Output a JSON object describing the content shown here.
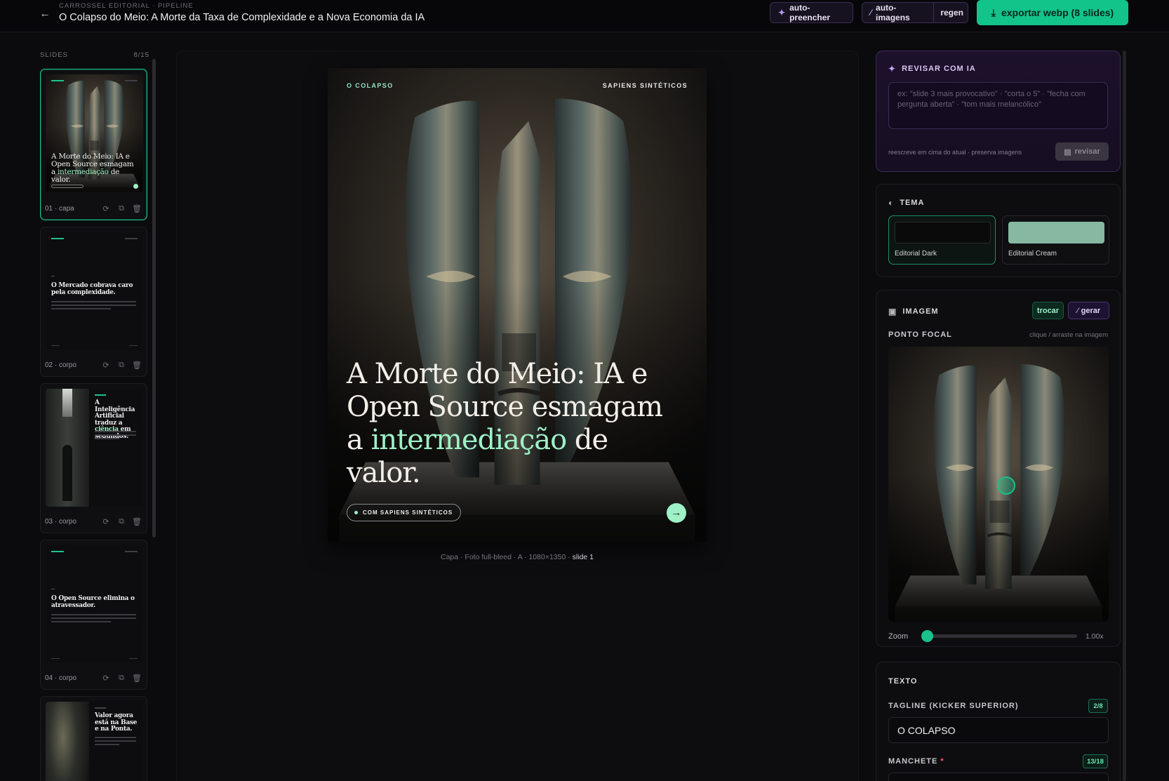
{
  "header": {
    "crumb": "CARROSSEL EDITORIAL · PIPELINE",
    "title": "O Colapso do Meio: A Morte da Taxa de Complexidade e a Nova Economia da IA",
    "auto_fill": "auto-preencher",
    "auto_images": "auto-imagens",
    "regen": "regen",
    "export": "exportar webp (8 slides)"
  },
  "sidebar": {
    "label": "SLIDES",
    "count": "8/15",
    "slides": [
      {
        "label": "01 · capa",
        "title": "A Morte do Meio: IA e Open Source esmagam a intermediação de valor."
      },
      {
        "label": "02 · corpo",
        "title": "O Mercado cobrava caro pela complexidade."
      },
      {
        "label": "03 · corpo",
        "title": "A Inteligência Artificial traduz a ciência em segundos."
      },
      {
        "label": "04 · corpo",
        "title": "O Open Source elimina o atravessador."
      },
      {
        "label": "05 · corpo",
        "title": "Valor agora está na Base e na Ponta."
      }
    ]
  },
  "card": {
    "tagline": "O COLAPSO",
    "brand": "SAPIENS SINTÉTICOS",
    "headline_pre": "A Morte do Meio: IA e Open Source esmagam a ",
    "headline_hl": "intermediação",
    "headline_post": " de valor.",
    "pill": "COM SAPIENS SINTÉTICOS",
    "next": "→"
  },
  "caption": {
    "meta": "Capa · Foto full-bleed · A · 1080×1350 ·",
    "slide": "slide 1"
  },
  "ai_panel": {
    "title": "REVISAR COM IA",
    "placeholder": "ex: \"slide 3 mais provocativo\" · \"corta o 5\" · \"fecha com pergunta aberta\" · \"tom mais melancólico\"",
    "hint": "reescreve em cima do atual · preserva imagens",
    "button": "revisar"
  },
  "theme_panel": {
    "title": "TEMA",
    "options": [
      {
        "name": "Editorial Dark",
        "color": "#0a0a0a"
      },
      {
        "name": "Editorial Cream",
        "color": "#86b8a2"
      }
    ]
  },
  "image_panel": {
    "title": "IMAGEM",
    "swap": "trocar",
    "generate": "gerar",
    "focal_label": "PONTO FOCAL",
    "focal_hint": "clique / arraste na imagem",
    "zoom_label": "Zoom",
    "zoom_value": "1.00x"
  },
  "text_panel": {
    "title": "TEXTO",
    "tagline_label": "TAGLINE (KICKER SUPERIOR)",
    "tagline_count": "2/8",
    "tagline_value": "O COLAPSO",
    "headline_label": "MANCHETE",
    "headline_req": "*",
    "headline_count": "13/18"
  },
  "colors": {
    "accent": "#12c48a",
    "highlight": "#9ef0c6",
    "ai": "#b79cf0"
  },
  "icons": [
    "arrow-left-icon",
    "sparkles-icon",
    "wand-icon",
    "download-icon",
    "refresh-icon",
    "copy-icon",
    "trash-icon",
    "palette-icon",
    "image-icon",
    "message-icon"
  ]
}
